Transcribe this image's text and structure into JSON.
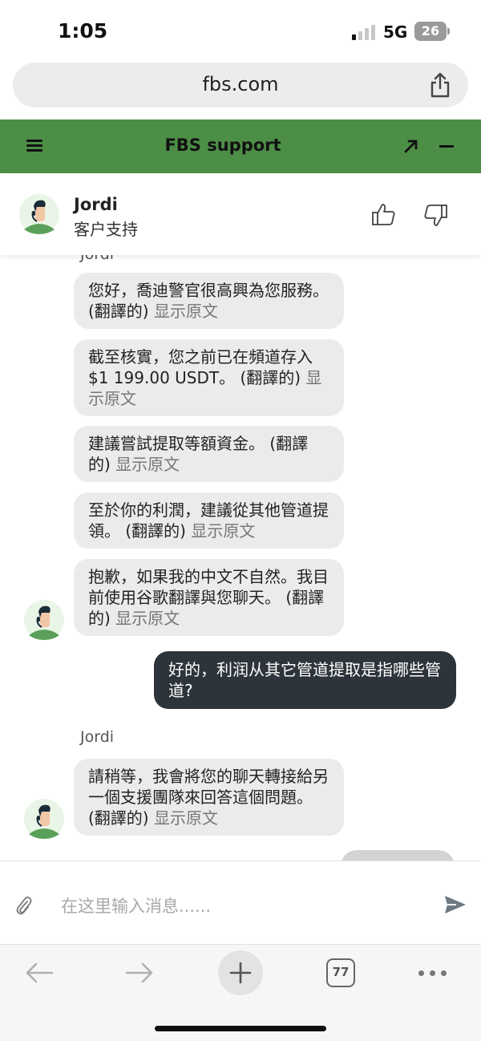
{
  "status_bar": {
    "time": "1:05",
    "network": "5G",
    "battery": "26"
  },
  "browser": {
    "url": "fbs.com",
    "tab_count": "77"
  },
  "header": {
    "title": "FBS support"
  },
  "agent": {
    "name": "Jordi",
    "role": "客户支持"
  },
  "chat": {
    "top_sender": "Jordi",
    "messages": [
      {
        "text": "您好，喬迪警官很高興為您服務。",
        "label": "(翻譯的)",
        "show_original": "显示原文"
      },
      {
        "text": "截至核實，您之前已在頻道存入$1 199.00 USDT。",
        "label": "(翻譯的)",
        "show_original": "显示原文"
      },
      {
        "text": "建議嘗試提取等額資金。",
        "label": "(翻譯的)",
        "show_original": "显示原文"
      },
      {
        "text": "至於你的利潤，建議從其他管道提領。",
        "label": "(翻譯的)",
        "show_original": "显示原文"
      },
      {
        "text": "抱歉，如果我的中文不自然。我目前使用谷歌翻譯與您聊天。",
        "label": "(翻譯的)",
        "show_original": "显示原文"
      }
    ],
    "user_message": "好的，利润从其它管道提取是指哪些管道?",
    "second_sender": "Jordi",
    "last_message": {
      "text": "請稍等，我會將您的聊天轉接給另一個支援團隊來回答這個問題。",
      "label": "(翻譯的)",
      "show_original": "显示原文"
    }
  },
  "input": {
    "placeholder": "在这里输入消息......"
  },
  "colors": {
    "header_green": "#4d8e47",
    "user_bubble": "#2d343b",
    "agent_bubble": "#ebebeb"
  },
  "icons": [
    "share-icon",
    "menu-icon",
    "expand-icon",
    "minimize-icon",
    "thumbs-up-icon",
    "thumbs-down-icon",
    "paperclip-icon",
    "send-icon",
    "back-arrow-icon",
    "forward-arrow-icon",
    "plus-icon",
    "more-icon"
  ]
}
